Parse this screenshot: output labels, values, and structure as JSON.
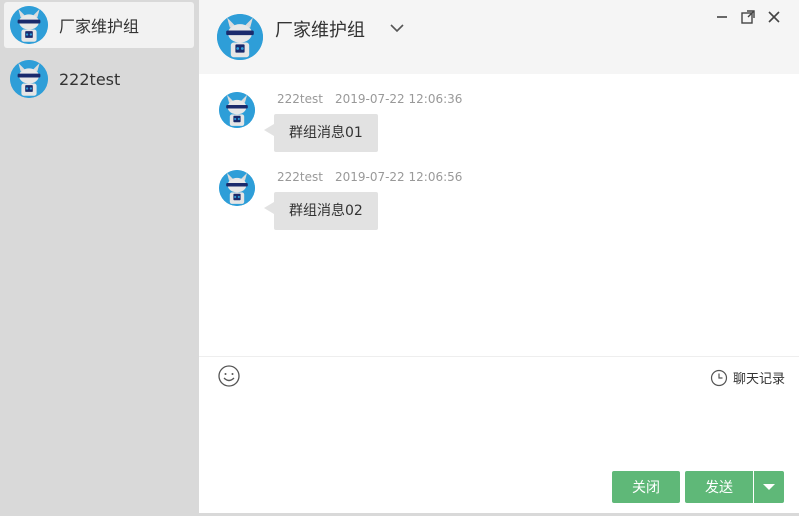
{
  "sidebar": {
    "items": [
      {
        "label": "厂家维护组",
        "active": true
      },
      {
        "label": "222test",
        "active": false
      }
    ]
  },
  "header": {
    "title": "厂家维护组",
    "expand_icon": "chevron-down-icon",
    "window_controls": [
      "minimize-icon",
      "maximize-icon",
      "close-icon"
    ]
  },
  "messages": [
    {
      "sender": "222test",
      "time": "2019-07-22 12:06:36",
      "text": "群组消息01"
    },
    {
      "sender": "222test",
      "time": "2019-07-22 12:06:56",
      "text": "群组消息02"
    }
  ],
  "toolbar": {
    "emoji_icon": "smiley-icon",
    "history_icon": "clock-icon",
    "history_label": "聊天记录"
  },
  "actions": {
    "close_label": "关闭",
    "send_label": "发送",
    "send_options_icon": "caret-down-icon"
  },
  "colors": {
    "sidebar_bg": "#d9d9d9",
    "header_bg": "#f5f5f5",
    "button_green": "#5fb878",
    "bubble_bg": "#e2e2e2",
    "avatar_blue": "#2e9ed8"
  }
}
